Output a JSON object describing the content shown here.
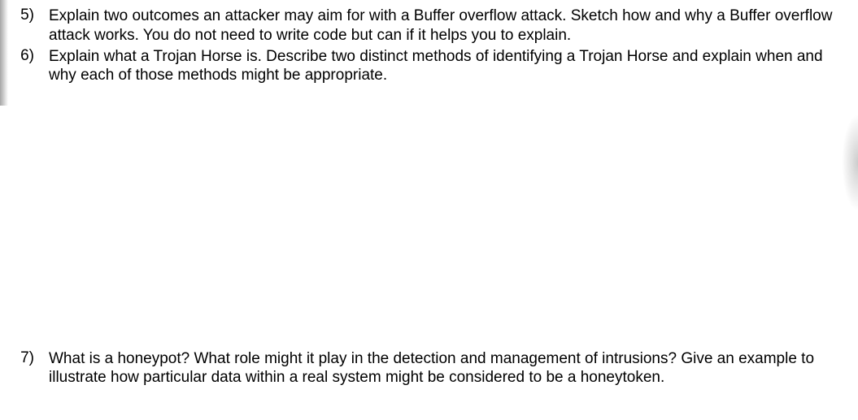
{
  "questions": [
    {
      "number": "5)",
      "text": "Explain two outcomes an attacker may aim for with a Buffer overflow attack. Sketch how and why a Buffer overflow attack works. You do not need to write code but can if it helps you to explain."
    },
    {
      "number": "6)",
      "text": "Explain what a Trojan Horse is. Describe two distinct methods of identifying a Trojan Horse and explain when and why each of those methods might be appropriate."
    },
    {
      "number": "7)",
      "text": "What is a honeypot? What role might it play in the detection and management of intrusions? Give an example to illustrate how particular data within a real system might be considered to be a honeytoken."
    }
  ]
}
